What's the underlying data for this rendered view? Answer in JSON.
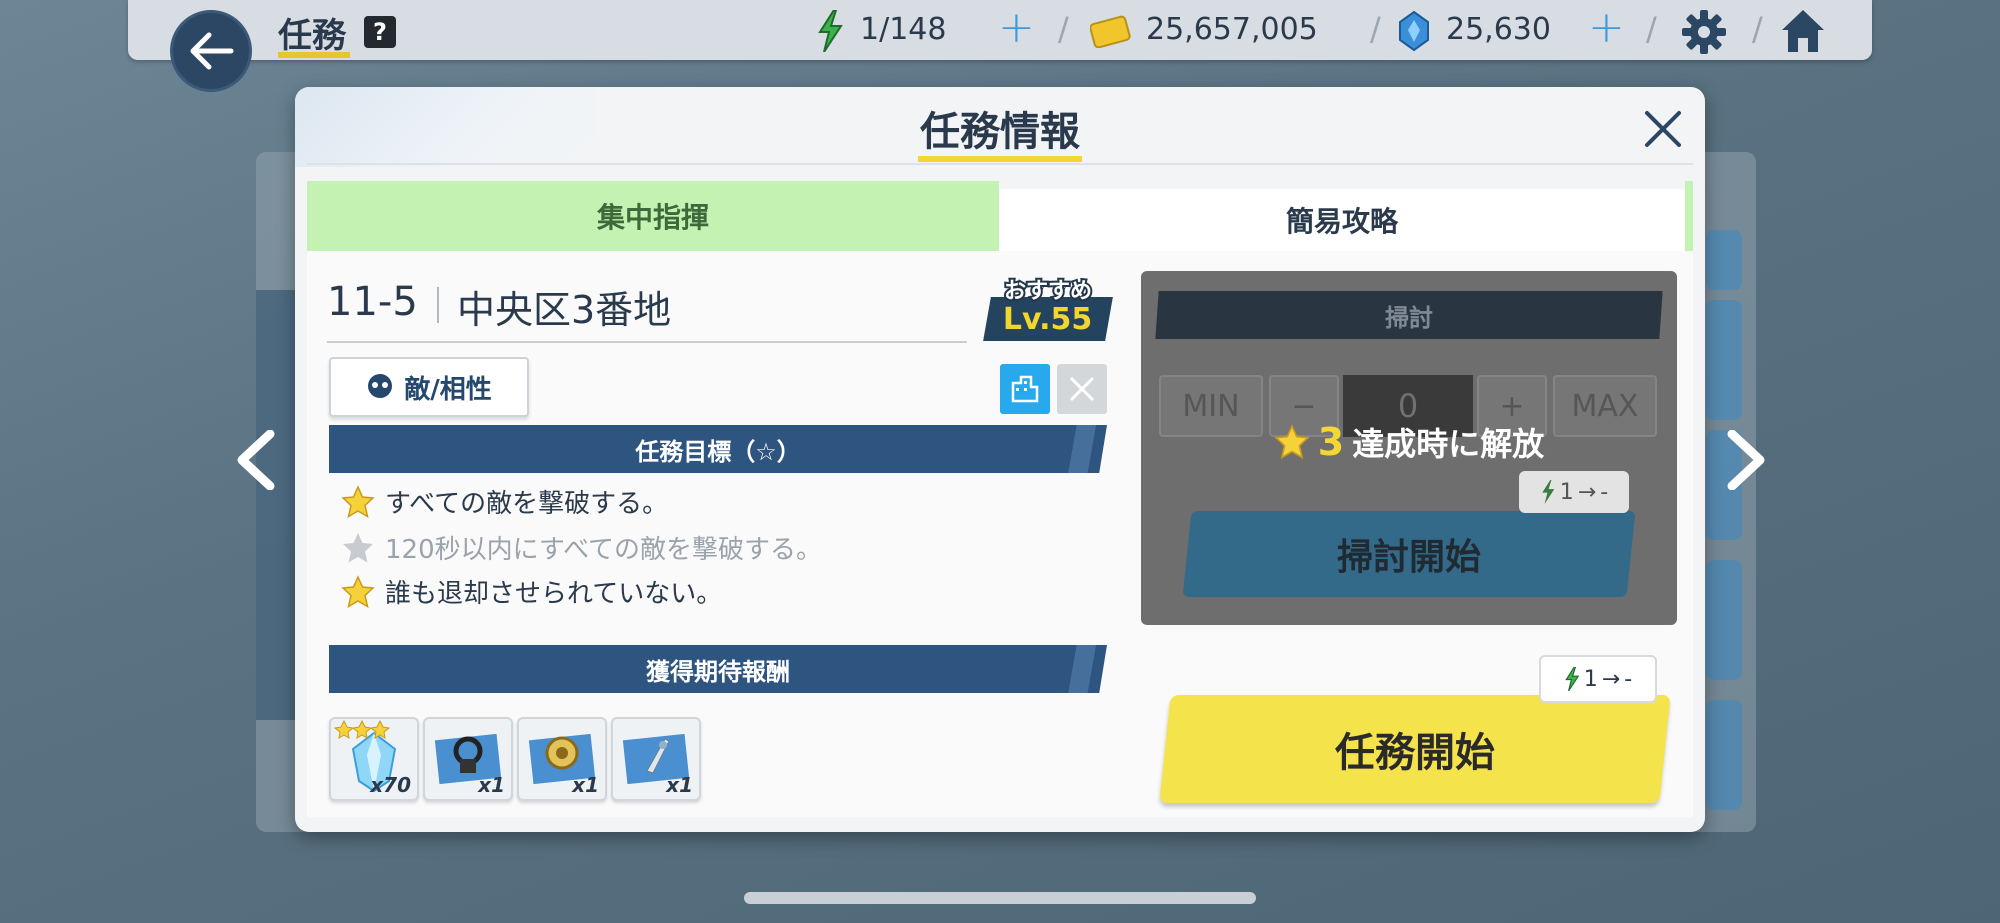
{
  "topbar": {
    "title": "任務",
    "help_icon": "?",
    "ap": "1/148",
    "credits": "25,657,005",
    "gems": "25,630"
  },
  "dialog": {
    "title": "任務情報",
    "tabs": [
      {
        "label": "集中指揮",
        "active": false
      },
      {
        "label": "簡易攻略",
        "active": true
      }
    ],
    "stage": {
      "id": "11-5",
      "name": "中央区3番地"
    },
    "recommended": {
      "label": "おすすめ",
      "level": "Lv.55"
    },
    "enemy_button": "敵/相性",
    "objectives_title": "任務目標（☆）",
    "objectives": [
      {
        "text": "すべての敵を撃破する。",
        "achieved": true
      },
      {
        "text": "120秒以内にすべての敵を撃破する。",
        "achieved": false
      },
      {
        "text": "誰も退却させられていない。",
        "achieved": true
      }
    ],
    "rewards_title": "獲得期待報酬",
    "rewards": [
      {
        "icon": "crystal-icon",
        "qty": "x70",
        "stars": 3
      },
      {
        "icon": "gear-item-icon",
        "qty": "x1"
      },
      {
        "icon": "badge-item-icon",
        "qty": "x1"
      },
      {
        "icon": "blueprint-item-icon",
        "qty": "x1"
      }
    ],
    "sweep": {
      "header": "掃討",
      "min": "MIN",
      "minus": "−",
      "count": "0",
      "plus": "+",
      "max": "MAX",
      "lock_star_count": "3",
      "lock_text": "達成時に解放",
      "cost": "1",
      "cost_arrow": "→",
      "cost_after": "-",
      "start": "掃討開始"
    },
    "start": {
      "label": "任務開始",
      "cost": "1",
      "cost_arrow": "→",
      "cost_after": "-"
    }
  },
  "colors": {
    "accent_yellow": "#f5e34c",
    "tab_green": "#c3f2b2",
    "navy": "#2e5580",
    "energy_green": "#3cb24a"
  }
}
